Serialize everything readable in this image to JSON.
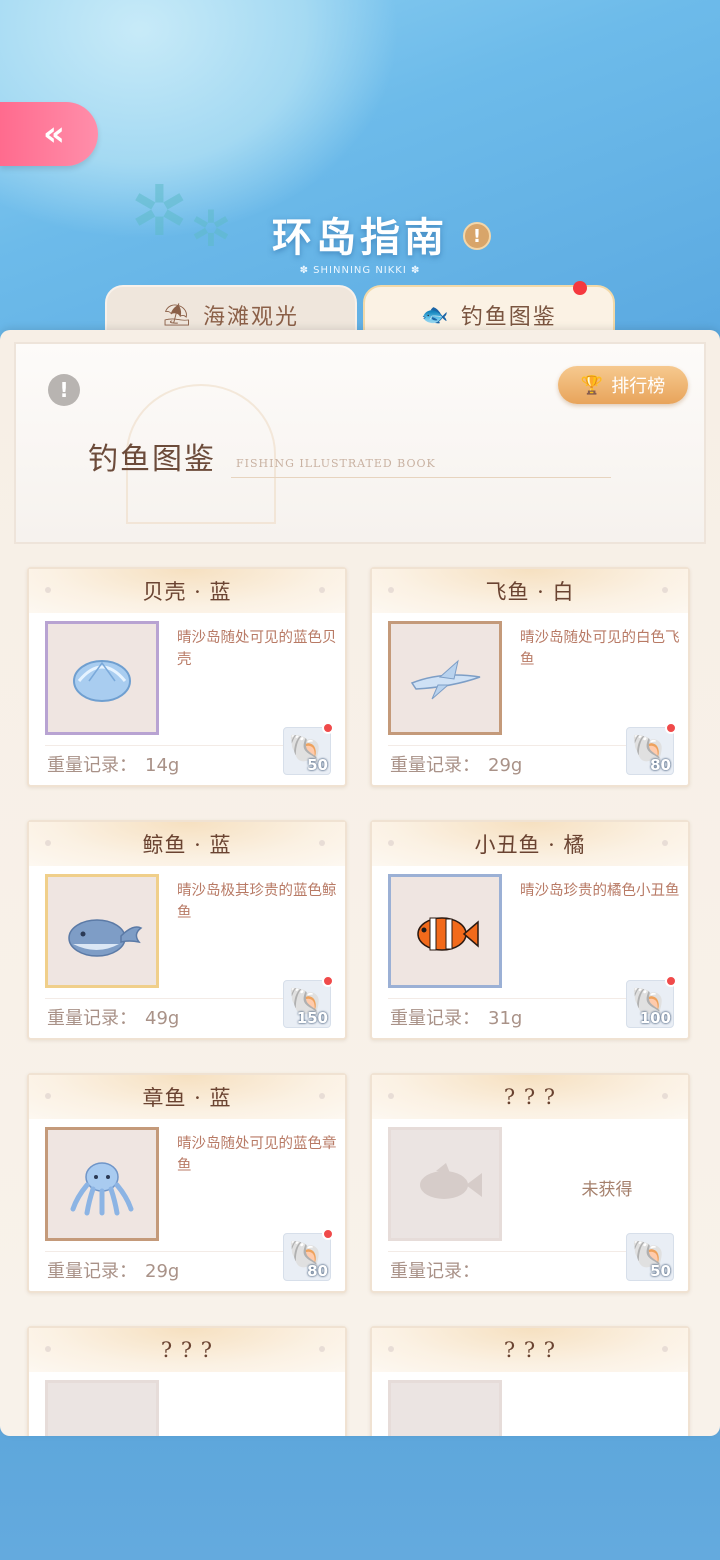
{
  "nav": {
    "back_icon_text": "«"
  },
  "header": {
    "title": "环岛指南",
    "subtitle": "✽ SHINNING NIKKI ✽",
    "info_text": "!"
  },
  "tabs": [
    {
      "label": "海滩观光",
      "icon": "umbrella-icon",
      "active": false
    },
    {
      "label": "钓鱼图鉴",
      "icon": "fish-icon",
      "active": true
    }
  ],
  "book": {
    "info_text": "!",
    "rank_label": "排行榜",
    "title": "钓鱼图鉴",
    "subtitle": "FISHING ILLUSTRATED BOOK"
  },
  "weight_label": "重量记录：",
  "cards": [
    {
      "name": "贝壳 · 蓝",
      "desc": "晴沙岛随处可见的蓝色贝壳",
      "weight": "14g",
      "reward": "50",
      "frame": "purple",
      "icon": "shell-icon"
    },
    {
      "name": "飞鱼 · 白",
      "desc": "晴沙岛随处可见的白色飞鱼",
      "weight": "29g",
      "reward": "80",
      "frame": "brown",
      "icon": "flying-fish-icon"
    },
    {
      "name": "鲸鱼 · 蓝",
      "desc": "晴沙岛极其珍贵的蓝色鲸鱼",
      "weight": "49g",
      "reward": "150",
      "frame": "gold",
      "icon": "whale-icon"
    },
    {
      "name": "小丑鱼 · 橘",
      "desc": "晴沙岛珍贵的橘色小丑鱼",
      "weight": "31g",
      "reward": "100",
      "frame": "blue",
      "icon": "clownfish-icon"
    },
    {
      "name": "章鱼 · 蓝",
      "desc": "晴沙岛随处可见的蓝色章鱼",
      "weight": "29g",
      "reward": "80",
      "frame": "brown",
      "icon": "octopus-icon"
    },
    {
      "name": "? ? ?",
      "locked_text": "未获得",
      "weight": "",
      "reward": "50",
      "frame": "gray",
      "icon": "fish-silhouette-icon"
    },
    {
      "name": "? ? ?"
    },
    {
      "name": "? ? ?"
    }
  ]
}
